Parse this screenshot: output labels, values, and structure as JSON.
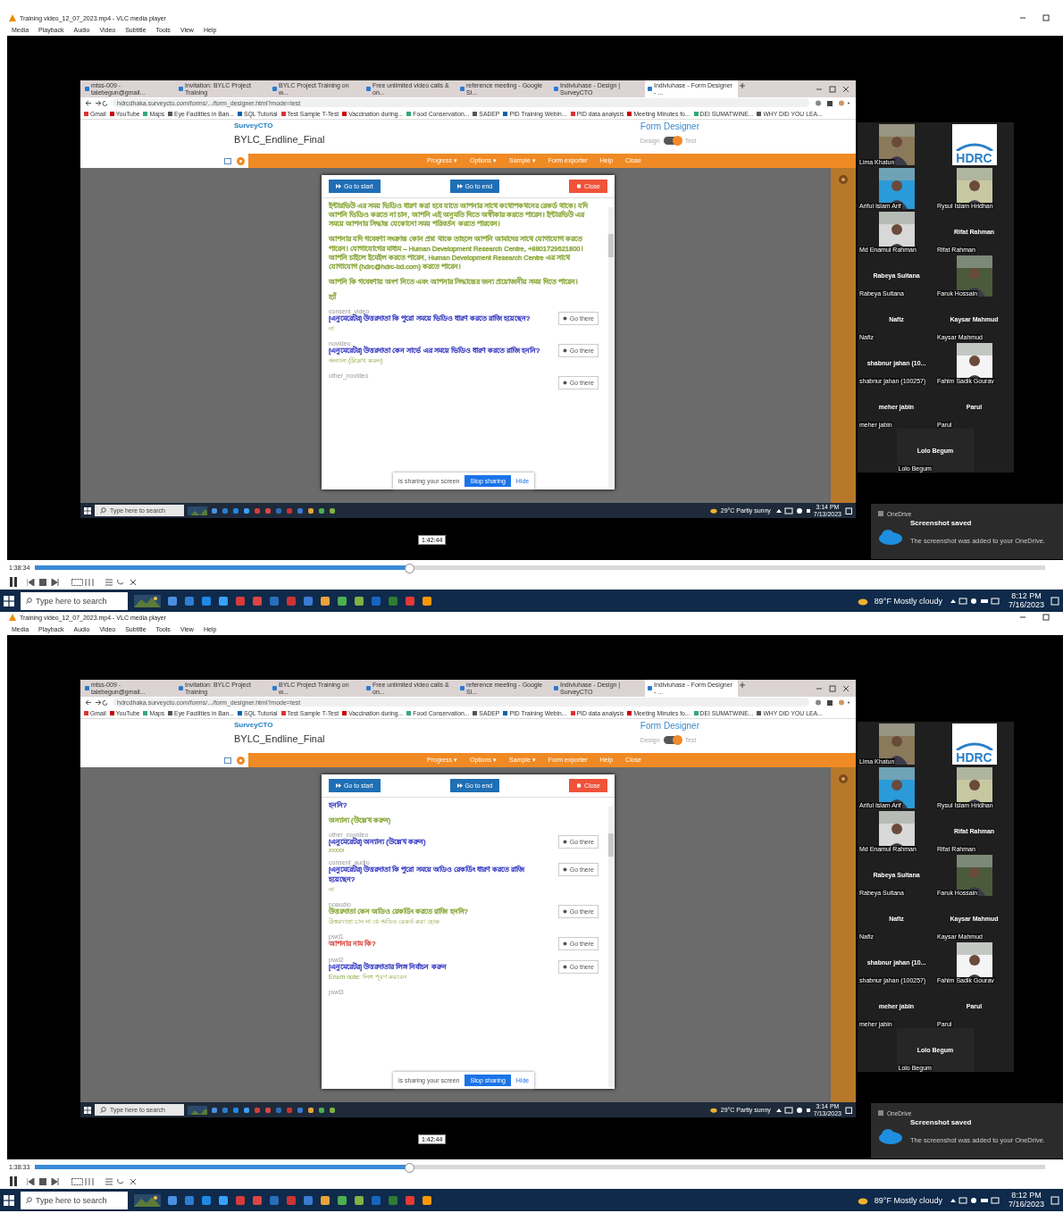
{
  "panels": [
    {
      "window": {
        "title": "Training video_12_07_2023.mp4 - VLC media player"
      },
      "menu": [
        "Media",
        "Playback",
        "Audio",
        "Video",
        "Subtitle",
        "Tools",
        "View",
        "Help"
      ],
      "browser": {
        "tabs": [
          {
            "label": "mtss-009 - talebegun@gmail...",
            "selected": false
          },
          {
            "label": "Invitation: BYLC Project Training",
            "selected": false
          },
          {
            "label": "BYLC Project Training on w...",
            "selected": false
          },
          {
            "label": "Free unlimited video calls & on...",
            "selected": false
          },
          {
            "label": "reference meeting - Google Sl...",
            "selected": false
          },
          {
            "label": "Indiviuhase - Design | SurveyCTO",
            "selected": false
          },
          {
            "label": "Indiviuhase - Form Designer - ...",
            "selected": true
          }
        ],
        "url": "hdrcdhaka.surveycto.com/forms/.../form_designer.html?mode=test",
        "bookmarks": [
          "Gmail",
          "YouTube",
          "Maps",
          "Eye Facilities in Ban...",
          "SQL Tutorial",
          "Test Sample T-Test",
          "Vaccination during...",
          "Food Conservation...",
          "SADEP",
          "PID Training Webin...",
          "PID data analysis",
          "Meeting Minutes fo...",
          "DEI SUMATWINE...",
          "WHY DID YOU LEA..."
        ],
        "brand": "SurveyCTO",
        "form_title": "BYLC_Endline_Final",
        "designer_title": "Form Designer",
        "toggle": {
          "left": "Design",
          "right": "Test",
          "on": true
        },
        "toolbar": [
          "Progress ▾",
          "Options ▾",
          "Sample ▾",
          "Form exporter",
          "Help",
          "Close"
        ],
        "modal": {
          "buttons": [
            {
              "label": "Go to start",
              "kind": "nav"
            },
            {
              "label": "Go to end",
              "kind": "nav"
            },
            {
              "label": "Close",
              "kind": "close"
            }
          ],
          "items": [
            {
              "kind": "paragraph",
              "color": "#8aa83a",
              "text": "ইন্টারভিউ এর সময় ভিডিও ধারণ করা হবে যাতে আপনার সাথে কথোপকথনের রেকর্ড থাকে। যদি আপনি ভিডিও করতে না চান, আপনি এই অনুমতি দিতে অস্বীকার করতে পারেন। ইন্টারভিউ এর সময়ে আপনার সিদ্ধান্ত যেকোনো সময় পরিবর্তন করতে পারবেন।"
            },
            {
              "kind": "paragraph",
              "color": "#8aa83a",
              "text": "আপনার যদি গবেষণা সংক্রান্ত কোন প্রশ্ন থাকে তাহলে আপনি আমাদের সাথে যোগাযোগ করতে পারেন। যোগাযোগের মাধ্যম – Human Development Research Centre, +8801729621800। আপনি চাইলে ইমেইল করতে পারেন, Human Development Research Centre এর সাথে যোগাযোগ (hdrc@hdrc-bd.com) করতে পারেন।"
            },
            {
              "kind": "paragraph",
              "color": "#8aa83a",
              "text": "আপনি কি গবেষণায় অংশ নিতে এবং আপনার সিদ্ধান্তের জন্য প্রয়োজনীয় সময় দিতে পারেন।"
            },
            {
              "kind": "answer",
              "color": "#8aa83a",
              "text": "হ্যাঁ"
            },
            {
              "kind": "question",
              "name": "consent_video",
              "color": "#3b3fc4",
              "text": "[এনুমেরেটর] উত্তরদাতা কি পুরো সময়ে ভিডিও ধারণ করতে রাজি হয়েছেন?",
              "note": "না",
              "button": "Go there"
            },
            {
              "kind": "question",
              "name": "novideo",
              "color": "#3b3fc4",
              "text": "[এনুমেরেটর] উত্তরদাতা কেন সার্ভে এর সময়ে ভিডিও ধারণ করতে রাজি হননি?",
              "note": "অন্যান্য (উল্লেখ করুন)",
              "button": "Go there"
            },
            {
              "kind": "question",
              "name": "other_novideo",
              "button": "Go there"
            }
          ],
          "share": {
            "text": "is sharing your screen",
            "stop": "Stop sharing",
            "hide": "Hide"
          }
        },
        "taskbar": {
          "search": "Type here to search",
          "weather": "29°C Partly sunny",
          "time": "3:14 PM",
          "date": "7/13/2023"
        }
      },
      "participants": [
        {
          "kind": "video",
          "name": "Lima Khatun"
        },
        {
          "kind": "logo",
          "logo": "HDRC"
        },
        {
          "kind": "video",
          "name": "Ariful Islam Arif"
        },
        {
          "kind": "video",
          "name": "Rysul Islam Hridhan"
        },
        {
          "kind": "video",
          "name": "Md Enamul Rahman"
        },
        {
          "kind": "name",
          "caption": "Rifat Rahman",
          "name": "Rifat Rahman"
        },
        {
          "kind": "name",
          "caption": "Rabeya Sultana",
          "name": "Rabeya Sultana"
        },
        {
          "kind": "video",
          "name": "Faruk Hossain"
        },
        {
          "kind": "name",
          "caption": "Nafiz",
          "name": "Nafiz"
        },
        {
          "kind": "name",
          "caption": "Kaysar Mahmud",
          "name": "Kaysar Mahmud"
        },
        {
          "kind": "name",
          "caption": "shabnur jahan (10...",
          "name": "shabnur jahan (100257)"
        },
        {
          "kind": "video",
          "name": "Fahim Sadik Gourav"
        },
        {
          "kind": "name",
          "caption": "meher jabin",
          "name": "meher jabin"
        },
        {
          "kind": "name",
          "caption": "Parul",
          "name": "Parul"
        },
        {
          "kind": "name",
          "caption": "Lolo Begum",
          "name": "Lolo Begum"
        }
      ],
      "toast": {
        "app": "OneDrive",
        "title": "Screenshot saved",
        "body": "The screenshot was added to your OneDrive."
      },
      "player": {
        "tooltip": "1:42:44",
        "time": "1:38:34",
        "level": 0.37
      },
      "taskbar": {
        "search": "Type here to search",
        "weather": "89°F Mostly cloudy",
        "time": "8:12 PM",
        "date": "7/16/2023"
      }
    },
    {
      "window": {
        "title": "Training video_12_07_2023.mp4 - VLC media player"
      },
      "menu": [
        "Media",
        "Playback",
        "Audio",
        "Video",
        "Subtitle",
        "Tools",
        "View",
        "Help"
      ],
      "browser": {
        "tabs": [
          {
            "label": "mtss-009 - talebegun@gmail...",
            "selected": false
          },
          {
            "label": "Invitation: BYLC Project Training",
            "selected": false
          },
          {
            "label": "BYLC Project Training on w...",
            "selected": false
          },
          {
            "label": "Free unlimited video calls & on...",
            "selected": false
          },
          {
            "label": "reference meeting - Google Sl...",
            "selected": false
          },
          {
            "label": "Indiviuhase - Design | SurveyCTO",
            "selected": false
          },
          {
            "label": "Indiviuhase - Form Designer - ...",
            "selected": true
          }
        ],
        "url": "hdrcdhaka.surveycto.com/forms/.../form_designer.html?mode=test",
        "bookmarks": [
          "Gmail",
          "YouTube",
          "Maps",
          "Eye Facilities in Ban...",
          "SQL Tutorial",
          "Test Sample T-Test",
          "Vaccination during...",
          "Food Conservation...",
          "SADEP",
          "PID Training Webin...",
          "PID data analysis",
          "Meeting Minutes fo...",
          "DEI SUMATWINE...",
          "WHY DID YOU LEA..."
        ],
        "brand": "SurveyCTO",
        "form_title": "BYLC_Endline_Final",
        "designer_title": "Form Designer",
        "toggle": {
          "left": "Design",
          "right": "Test",
          "on": true
        },
        "toolbar": [
          "Progress ▾",
          "Options ▾",
          "Sample ▾",
          "Form exporter",
          "Help",
          "Close"
        ],
        "modal": {
          "buttons": [
            {
              "label": "Go to start",
              "kind": "nav"
            },
            {
              "label": "Go to end",
              "kind": "nav"
            },
            {
              "label": "Close",
              "kind": "close"
            }
          ],
          "items": [
            {
              "kind": "answer",
              "color": "#3b3fc4",
              "text": "হননি?"
            },
            {
              "kind": "answer",
              "color": "#8aa83a",
              "text": "অন্যান্য (উল্লেখ করুন)"
            },
            {
              "kind": "question",
              "name": "other_novideo",
              "color": "#3b3fc4",
              "text": "[এনুমেরেটর] অন্যান্য (উল্লেখ করুন)",
              "note": "xxxxx",
              "button": "Go there"
            },
            {
              "kind": "question",
              "name": "consent_audio",
              "color": "#3b3fc4",
              "text": "[এনুমেরেটর] উত্তরদাতা কি পুরো সময়ে অডিও রেকর্ডিং ধারণ করতে রাজি হয়েছেন?",
              "note": "না",
              "button": "Go there"
            },
            {
              "kind": "question",
              "name": "noaudio",
              "color": "#8aa83a",
              "text": "উত্তরদাতা কেন অডিও রেকর্ডিং করতে রাজি হননি?",
              "note": "উত্তরদাতা চান না যে অডিও রেকর্ড করা হোক",
              "button": "Go there"
            },
            {
              "kind": "question",
              "name": "pwd1",
              "color": "#d9534f",
              "text": "আপনার নাম কি?",
              "button": "Go there"
            },
            {
              "kind": "question",
              "name": "pwd2",
              "color": "#3b3fc4",
              "text": "[এনুমেরেটর] উত্তরদাতার লিঙ্গ নির্বাচন করুন",
              "note": "Enum note: লিঙ্গ পূরণ করবেন",
              "button": "Go there"
            },
            {
              "kind": "question",
              "name": "pwd3"
            }
          ],
          "share": {
            "text": "is sharing your screen",
            "stop": "Stop sharing",
            "hide": "Hide"
          }
        },
        "taskbar": {
          "search": "Type here to search",
          "weather": "29°C Partly sunny",
          "time": "3:14 PM",
          "date": "7/13/2023"
        }
      },
      "participants": [
        {
          "kind": "video",
          "name": "Lima Khatun"
        },
        {
          "kind": "logo",
          "logo": "HDRC"
        },
        {
          "kind": "video",
          "name": "Ariful Islam Arif"
        },
        {
          "kind": "video",
          "name": "Rysul Islam Hridhan"
        },
        {
          "kind": "video",
          "name": "Md Enamul Rahman"
        },
        {
          "kind": "name",
          "caption": "Rifat Rahman",
          "name": "Rifat Rahman"
        },
        {
          "kind": "name",
          "caption": "Rabeya Sultana",
          "name": "Rabeya Sultana"
        },
        {
          "kind": "video",
          "name": "Faruk Hossain"
        },
        {
          "kind": "name",
          "caption": "Nafiz",
          "name": "Nafiz"
        },
        {
          "kind": "name",
          "caption": "Kaysar Mahmud",
          "name": "Kaysar Mahmud"
        },
        {
          "kind": "name",
          "caption": "shabnur jahan (10...",
          "name": "shabnur jahan (100257)"
        },
        {
          "kind": "video",
          "name": "Fahim Sadik Gourav"
        },
        {
          "kind": "name",
          "caption": "meher jabin",
          "name": "meher jabin"
        },
        {
          "kind": "name",
          "caption": "Parul",
          "name": "Parul"
        },
        {
          "kind": "name",
          "caption": "Lolo Begum",
          "name": "Lolo Begum"
        }
      ],
      "toast": {
        "app": "OneDrive",
        "title": "Screenshot saved",
        "body": "The screenshot was added to your OneDrive."
      },
      "player": {
        "tooltip": "1:42:44",
        "time": "1:38:33",
        "level": 0.37
      },
      "taskbar": {
        "search": "Type here to search",
        "weather": "89°F Mostly cloudy",
        "time": "8:12 PM",
        "date": "7/16/2023"
      }
    }
  ]
}
